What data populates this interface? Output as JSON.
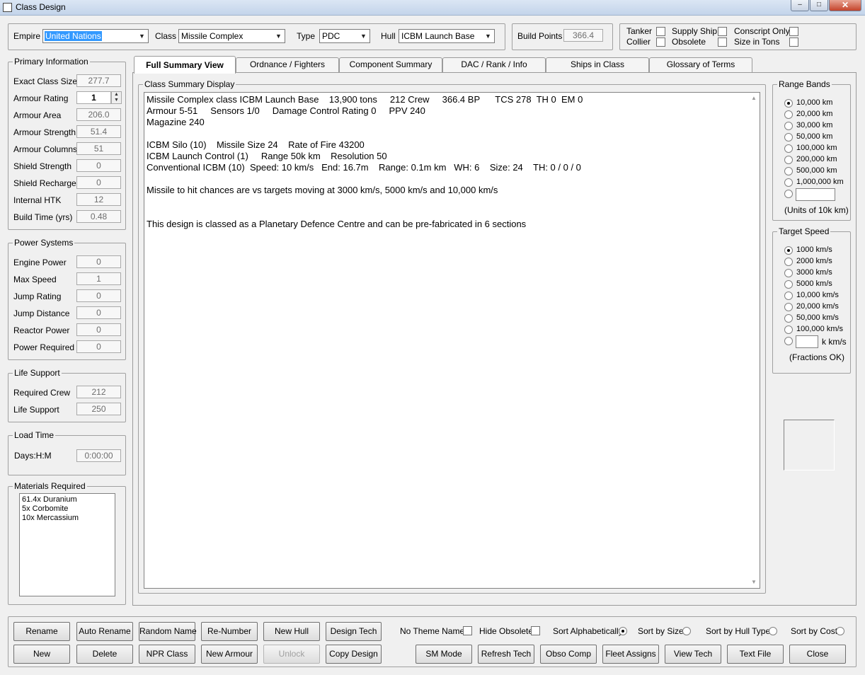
{
  "window": {
    "title": "Class Design",
    "min": "–",
    "max": "□",
    "close": "✕"
  },
  "top": {
    "empire_label": "Empire",
    "empire_value": "United Nations",
    "class_label": "Class",
    "class_value": "Missile Complex",
    "type_label": "Type",
    "type_value": "PDC",
    "hull_label": "Hull",
    "hull_value": "ICBM Launch Base",
    "build_points_label": "Build Points",
    "build_points_value": "366.4",
    "flags": {
      "tanker": "Tanker",
      "collier": "Collier",
      "supply_ship": "Supply Ship",
      "obsolete": "Obsolete",
      "conscript_only": "Conscript Only",
      "size_in_tons": "Size in Tons"
    }
  },
  "primary": {
    "title": "Primary Information",
    "rows": [
      {
        "label": "Exact Class Size",
        "value": "277.7"
      },
      {
        "label": "Armour Rating",
        "value": "1"
      },
      {
        "label": "Armour Area",
        "value": "206.0"
      },
      {
        "label": "Armour Strength",
        "value": "51.4"
      },
      {
        "label": "Armour Columns",
        "value": "51"
      },
      {
        "label": "Shield Strength",
        "value": "0"
      },
      {
        "label": "Shield Recharge",
        "value": "0"
      },
      {
        "label": "Internal HTK",
        "value": "12"
      },
      {
        "label": "Build Time (yrs)",
        "value": "0.48"
      }
    ]
  },
  "power": {
    "title": "Power Systems",
    "rows": [
      {
        "label": "Engine Power",
        "value": "0"
      },
      {
        "label": "Max Speed",
        "value": "1"
      },
      {
        "label": "Jump Rating",
        "value": "0"
      },
      {
        "label": "Jump Distance",
        "value": "0"
      },
      {
        "label": "Reactor Power",
        "value": "0"
      },
      {
        "label": "Power Required",
        "value": "0"
      }
    ]
  },
  "life": {
    "title": "Life Support",
    "rows": [
      {
        "label": "Required Crew",
        "value": "212"
      },
      {
        "label": "Life Support",
        "value": "250"
      }
    ]
  },
  "load": {
    "title": "Load Time",
    "label": "Days:H:M",
    "value": "0:00:00"
  },
  "materials": {
    "title": "Materials Required",
    "items": [
      "61.4x Duranium",
      "5x Corbomite",
      "10x Mercassium"
    ]
  },
  "tabs": [
    "Full Summary View",
    "Ordnance / Fighters",
    "Component Summary",
    "DAC / Rank / Info",
    "Ships in Class",
    "Glossary of Terms"
  ],
  "summary": {
    "title": "Class Summary Display",
    "lines": [
      "Missile Complex class ICBM Launch Base    13,900 tons     212 Crew     366.4 BP      TCS 278  TH 0  EM 0",
      "Armour 5-51     Sensors 1/0     Damage Control Rating 0     PPV 240",
      "Magazine 240",
      "",
      "ICBM Silo (10)    Missile Size 24    Rate of Fire 43200",
      "ICBM Launch Control (1)     Range 50k km    Resolution 50",
      "Conventional ICBM (10)  Speed: 10 km/s   End: 16.7m    Range: 0.1m km   WH: 6    Size: 24    TH: 0 / 0 / 0",
      "",
      "Missile to hit chances are vs targets moving at 3000 km/s, 5000 km/s and 10,000 km/s",
      "",
      "",
      "This design is classed as a Planetary Defence Centre and can be pre-fabricated in 6 sections"
    ]
  },
  "range_bands": {
    "title": "Range Bands",
    "options": [
      "10,000 km",
      "20,000 km",
      "30,000 km",
      "50,000 km",
      "100,000 km",
      "200,000 km",
      "500,000 km",
      "1,000,000 km"
    ],
    "selected_index": 0,
    "custom_value": "",
    "note": "(Units of 10k km)"
  },
  "target_speed": {
    "title": "Target Speed",
    "options": [
      "1000 km/s",
      "2000 km/s",
      "3000 km/s",
      "5000 km/s",
      "10,000 km/s",
      "20,000 km/s",
      "50,000 km/s",
      "100,000 km/s"
    ],
    "selected_index": 0,
    "custom_value": "",
    "custom_unit": "k km/s",
    "note": "(Fractions OK)"
  },
  "buttons_row1": [
    "Rename",
    "Auto Rename",
    "Random Name",
    "Re-Number",
    "New Hull",
    "Design Tech"
  ],
  "buttons_row2": [
    "New",
    "Delete",
    "NPR Class",
    "New Armour",
    "Unlock",
    "Copy Design"
  ],
  "options_row": {
    "no_theme_name": "No Theme Name",
    "hide_obsolete": "Hide Obsolete",
    "sort_alpha": "Sort Alphabetically",
    "sort_size": "Sort by Size",
    "sort_hull": "Sort by Hull Type",
    "sort_cost": "Sort by Cost"
  },
  "buttons_row2_right": [
    "SM Mode",
    "Refresh Tech",
    "Obso Comp",
    "Fleet Assigns",
    "View Tech",
    "Text File",
    "Close"
  ]
}
